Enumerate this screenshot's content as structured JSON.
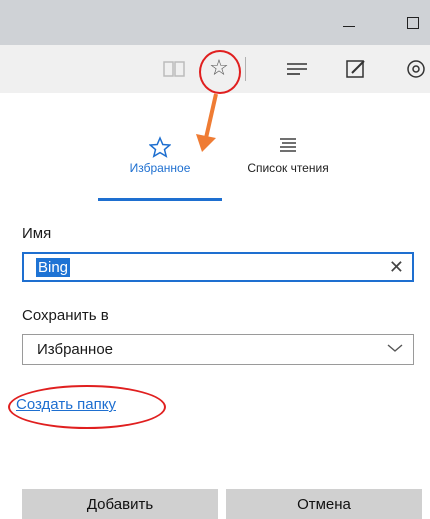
{
  "titlebar": {},
  "toolbar": {
    "icons": [
      "reading-view-icon",
      "star-icon",
      "hub-icon",
      "web-note-icon",
      "share-icon"
    ]
  },
  "tabs": [
    {
      "label": "Избранное",
      "icon": "star-icon",
      "active": true
    },
    {
      "label": "Список чтения",
      "icon": "reading-list-icon",
      "active": false
    }
  ],
  "form": {
    "name_label": "Имя",
    "name_value": "Bing",
    "save_in_label": "Сохранить в",
    "folder_value": "Избранное",
    "create_folder_link": "Создать папку"
  },
  "actions": {
    "add": "Добавить",
    "cancel": "Отмена"
  },
  "colors": {
    "accent": "#1e6fd0",
    "annotation_red": "#e01f1f",
    "annotation_arrow": "#ef7c34"
  }
}
